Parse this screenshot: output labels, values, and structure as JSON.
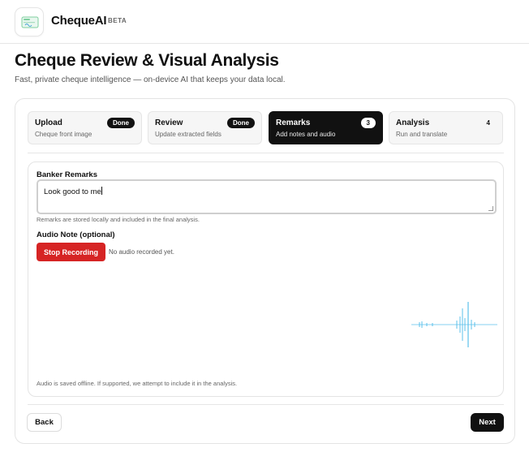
{
  "header": {
    "brand": "ChequeAI",
    "badge": "BETA"
  },
  "page": {
    "title": "Cheque Review & Visual Analysis",
    "subtitle": "Fast, private cheque intelligence — on-device AI that keeps your data local."
  },
  "steps": [
    {
      "title": "Upload",
      "subtitle": "Cheque front image",
      "badge": "Done",
      "state": "done"
    },
    {
      "title": "Review",
      "subtitle": "Update extracted fields",
      "badge": "Done",
      "state": "done"
    },
    {
      "title": "Remarks",
      "subtitle": "Add notes and audio",
      "badge": "3",
      "state": "active"
    },
    {
      "title": "Analysis",
      "subtitle": "Run and translate",
      "badge": "4",
      "state": "pending"
    }
  ],
  "remarks": {
    "label": "Banker Remarks",
    "value": "Look good to me",
    "hint": "Remarks are stored locally and included in the final analysis."
  },
  "audio": {
    "label": "Audio Note (optional)",
    "stop_label": "Stop Recording",
    "status": "No audio recorded yet.",
    "hint": "Audio is saved offline. If supported, we attempt to include it in the analysis."
  },
  "nav": {
    "back_label": "Back",
    "next_label": "Next"
  },
  "colors": {
    "accent": "#111111",
    "record": "#d62424",
    "waveform": "#5bc0eb"
  },
  "icons": {
    "logo": "cheque-icon"
  }
}
